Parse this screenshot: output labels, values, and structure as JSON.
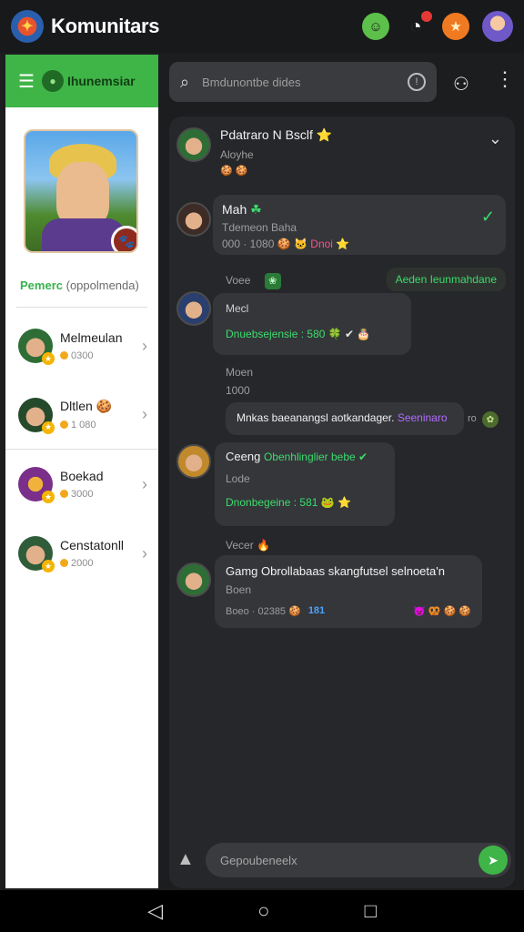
{
  "app": {
    "title": "Komunitars"
  },
  "colors": {
    "accent": "#3fb548",
    "panel": "#26272a",
    "bubble": "#34363a"
  },
  "sidebar": {
    "header_title": "Ihunemsiar",
    "profile": {
      "caption_highlight": "Pemerc",
      "caption_rest": "(oppolmenda)"
    },
    "friends": [
      {
        "name": "Melmeulan",
        "coins": "0300"
      },
      {
        "name": "Dltlen 🍪",
        "coins": "1 080"
      },
      {
        "name": "Boekad",
        "coins": "3000"
      },
      {
        "name": "Censtatonll",
        "coins": "2000"
      }
    ]
  },
  "search": {
    "placeholder": "Bmdunontbe dides"
  },
  "chat": {
    "pinned": {
      "name": "Pdatraro N Bsclf ⭐",
      "sub": "Aloyhe",
      "emojis": "🍪 🍪"
    },
    "msg1": {
      "name": "Mah",
      "sub": "Tdemeon Baha",
      "line_a": "000 · 1080 🍪 🐱",
      "line_pink": "Dnoi",
      "line_b": "⭐"
    },
    "sys1": {
      "label": "Voee",
      "tag": "Aeden Ieunmahdane"
    },
    "msg2": {
      "name": "Mecl",
      "line_green": "Dnuebsejensie : 580",
      "line_emoji": "🍀 ✔ 🎂"
    },
    "sys2": {
      "label": "Moen",
      "sub": "1000"
    },
    "msg3": {
      "text": "Mnkas baeanangsl aotkandager.",
      "text_purple": "Seeninaro",
      "suffix": "ro"
    },
    "msg4": {
      "name": "Ceeng",
      "name_green": "Obenhlinglier bebe ✔",
      "sub": "Lode",
      "line_green": "Dnonbegeine : 581",
      "line_emoji": "🐸 ⭐"
    },
    "sys3": {
      "label": "Vecer"
    },
    "msg5": {
      "text": "Gamg Obrollabaas skangfutsel selnoeta'n",
      "sub": "Boen",
      "meta": "Boeo · 02385 🍪",
      "meta_blue": "181",
      "emojis": "👿 🥨 🍪 🍪"
    }
  },
  "composer": {
    "placeholder": "Gepoubeneelx"
  },
  "icons": {
    "search": "search-icon",
    "user": "user-icon",
    "more": "more-icon",
    "send": "send-icon",
    "attach": "attach-icon"
  }
}
